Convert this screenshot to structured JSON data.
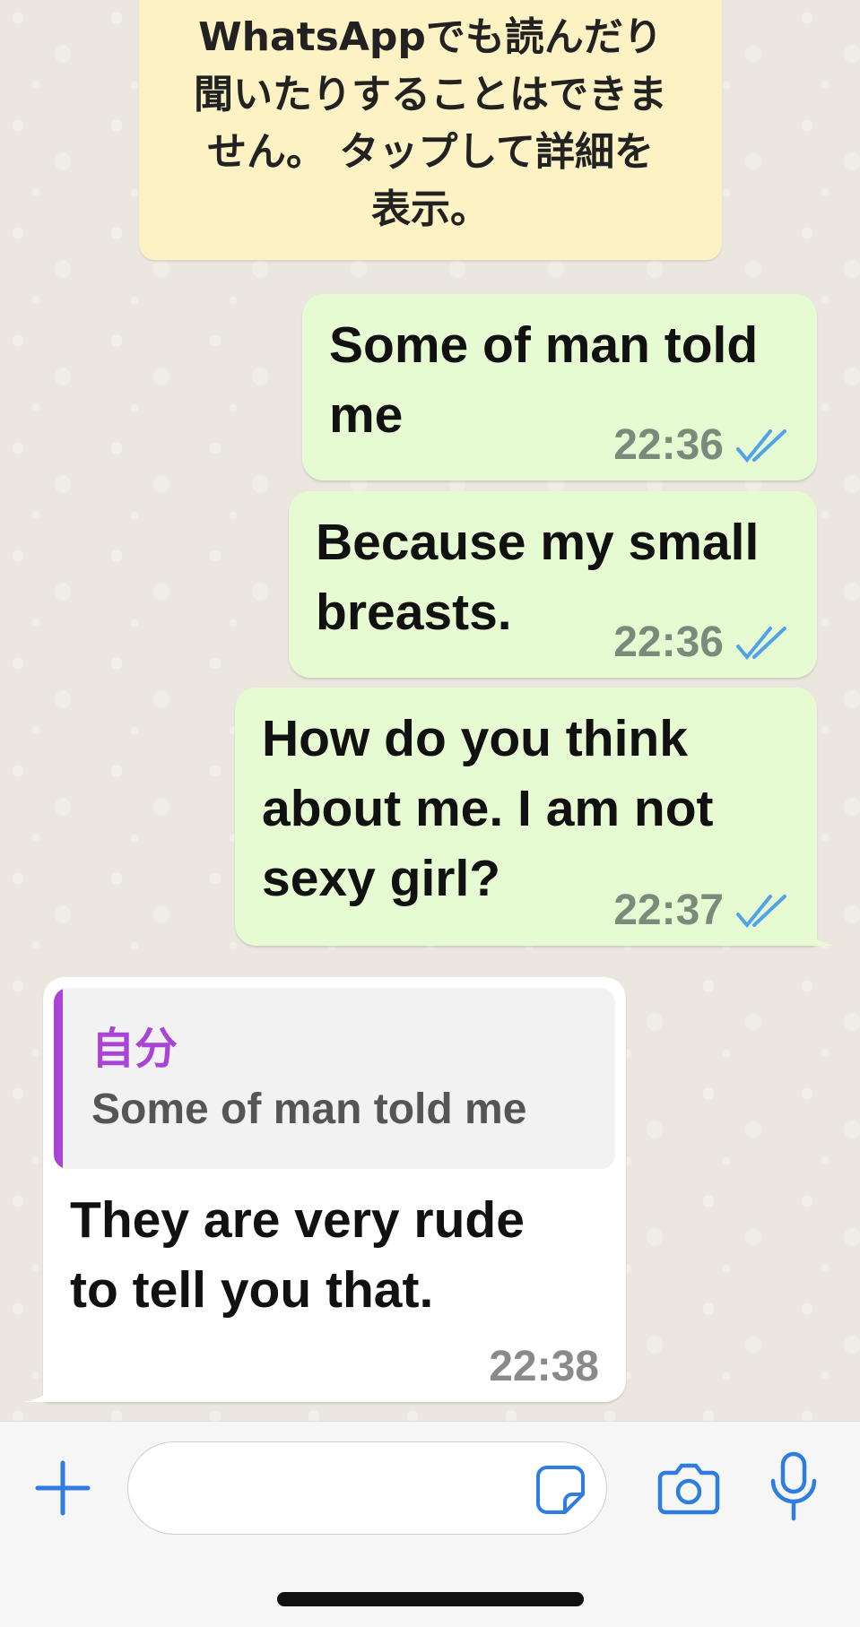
{
  "system_notice": {
    "lines": [
      "WhatsAppでも読んだり",
      "聞いたりすることはできま",
      "せん。 タップして詳細を",
      "表示。"
    ]
  },
  "messages": [
    {
      "direction": "out",
      "lines": [
        "Some of man told",
        "me"
      ],
      "time": "22:36",
      "status": "read"
    },
    {
      "direction": "out",
      "lines": [
        "Because my small",
        "breasts."
      ],
      "time": "22:36",
      "status": "read"
    },
    {
      "direction": "out",
      "lines": [
        "How do you think",
        "about me. I am not",
        "sexy girl?"
      ],
      "time": "22:37",
      "status": "read"
    },
    {
      "direction": "in",
      "quote": {
        "author": "自分",
        "text": "Some of man told me"
      },
      "lines": [
        "They are very rude",
        "to tell you that."
      ],
      "time": "22:38"
    }
  ],
  "composer": {
    "placeholder": "",
    "icons": {
      "add": "plus-icon",
      "sticker": "sticker-icon",
      "camera": "camera-icon",
      "mic": "microphone-icon"
    }
  },
  "colors": {
    "outgoing_bubble": "#e7fbd3",
    "incoming_bubble": "#ffffff",
    "notice_bubble": "#fdf2c4",
    "quote_accent": "#a944d6",
    "read_ticks": "#4fa3e6",
    "icon_blue": "#2f7de1"
  }
}
